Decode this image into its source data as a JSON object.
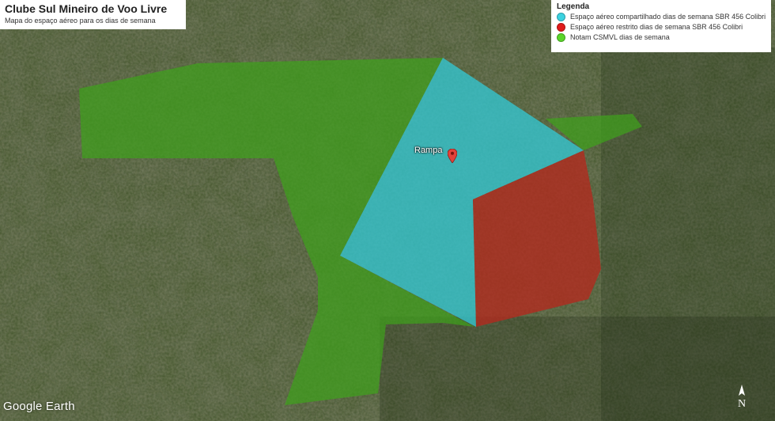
{
  "title": {
    "main": "Clube Sul Mineiro de Voo Livre",
    "subtitle": "Mapa do espaço aéreo para os dias de semana"
  },
  "legend": {
    "title": "Legenda",
    "items": [
      {
        "label": "Espaço aéreo compartilhado dias de semana SBR 456 Colibri",
        "color": "#3cd2e0"
      },
      {
        "label": "Espaço aéreo restrito dias de semana SBR 456 Colibri",
        "color": "#e01b1b"
      },
      {
        "label": "Notam CSMVL dias de semana",
        "color": "#5ad52a"
      }
    ]
  },
  "map": {
    "marker_label": "Rampa",
    "marker_icon": "map-pin-icon",
    "zones": [
      {
        "name": "green-zone",
        "fill": "#3fa11c"
      },
      {
        "name": "cyan-zone",
        "fill": "#33c6d2"
      },
      {
        "name": "red-zone",
        "fill": "#b3291e"
      }
    ]
  },
  "branding": {
    "logo": "Google Earth",
    "compass_letter": "N"
  }
}
